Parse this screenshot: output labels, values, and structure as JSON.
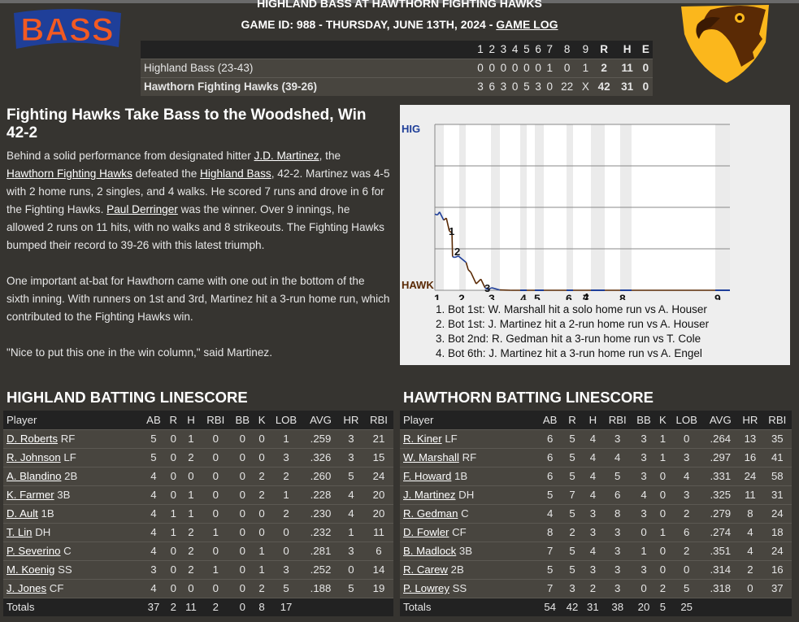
{
  "header": {
    "title": "HIGHLAND BASS AT HAWTHORN FIGHTING HAWKS",
    "subtitle": "GAME ID: 988 - THURSDAY, JUNE 13TH, 2024 - ",
    "game_log_link": "GAME LOG",
    "away_logo_text": "BASS",
    "colors": {
      "bass_orange": "#f25a23",
      "bass_blue": "#1f3f99",
      "hawk_gold": "#fbb71c",
      "hawk_brown": "#5a2a05"
    }
  },
  "linescore": {
    "headers": [
      "",
      "1",
      "2",
      "3",
      "4",
      "5",
      "6",
      "7",
      "8",
      "9",
      "R",
      "H",
      "E"
    ],
    "rows": [
      [
        "Highland Bass (23-43)",
        "0",
        "0",
        "0",
        "0",
        "0",
        "0",
        "1",
        "0",
        "1",
        "2",
        "11",
        "0"
      ],
      [
        "Hawthorn Fighting Hawks (39-26)",
        "3",
        "6",
        "3",
        "0",
        "5",
        "3",
        "0",
        "22",
        "X",
        "42",
        "31",
        "0"
      ]
    ]
  },
  "article": {
    "headline": "Fighting Hawks Take Bass to the Woodshed, Win 42-2",
    "p1": [
      {
        "t": "Behind a solid performance from designated hitter "
      },
      {
        "t": "J.D. Martinez",
        "link": true
      },
      {
        "t": ", the "
      },
      {
        "t": "Hawthorn Fighting Hawks",
        "link": true
      },
      {
        "t": " defeated the "
      },
      {
        "t": "Highland Bass",
        "link": true
      },
      {
        "t": ", 42-2. Martinez was 4-5 with 2 home runs, 2 singles, and 4 walks. He scored 7 runs and drove in 6 for the Fighting Hawks. "
      },
      {
        "t": "Paul Derringer",
        "link": true
      },
      {
        "t": " was the winner. Over 9 innings, he allowed 2 runs on 11 hits, with no walks and 8 strikeouts. The Fighting Hawks bumped their record to 39-26 with this latest triumph."
      }
    ],
    "p2": "One important at-bat for Hawthorn came with one out in the bottom of the sixth inning. With runners on 1st and 3rd, Martinez hit a 3-run home run, which contributed to the Fighting Hawks win.",
    "p3": "\"Nice to put this one in the win column,\" said Martinez."
  },
  "chart_data": {
    "type": "line",
    "top_label": "HIG",
    "bottom_label": "HAWK",
    "top_color": "#1f3f99",
    "bottom_color": "#5a2a05",
    "ylim": [
      0,
      100
    ],
    "xlim": [
      0,
      100
    ],
    "grid": true,
    "inning_labels": [
      "1",
      "2",
      "3",
      "4",
      "5",
      "6",
      "7",
      "8",
      "9"
    ],
    "points": [
      [
        0,
        45.9
      ],
      [
        0.9,
        45.4
      ],
      [
        1.6,
        47.2
      ],
      [
        3.0,
        42.3
      ],
      [
        3.9,
        43.5
      ],
      [
        4.9,
        35.8
      ],
      [
        5.8,
        34.5
      ],
      [
        6.0,
        20.3
      ],
      [
        6.7,
        19.8
      ],
      [
        8.0,
        20.6
      ],
      [
        10.6,
        16.8
      ],
      [
        11.3,
        12.4
      ],
      [
        12.2,
        10.8
      ],
      [
        14.0,
        3.9
      ],
      [
        15.6,
        6.7
      ],
      [
        17.0,
        1.5
      ],
      [
        17.9,
        0.5
      ],
      [
        19.3,
        1.5
      ],
      [
        22.0,
        0.2
      ],
      [
        25.7,
        0
      ],
      [
        100,
        0
      ]
    ],
    "annotations": [
      "1",
      "2",
      "3",
      "4"
    ],
    "notes": [
      "1. Bot 1st: W. Marshall hit a solo home run vs A. Houser",
      "2. Bot 1st: J. Martinez hit a 2-run home run vs A. Houser",
      "3. Bot 2nd: R. Gedman hit a 3-run home run vs T. Cole",
      "4. Bot 6th: J. Martinez hit a 3-run home run vs A. Engel"
    ]
  },
  "batting": [
    {
      "title": "HIGHLAND BATTING LINESCORE",
      "headers": [
        "Player",
        "AB",
        "R",
        "H",
        "RBI",
        "BB",
        "K",
        "LOB",
        "AVG",
        "HR",
        "RBI"
      ],
      "rows": [
        [
          "D. Roberts",
          "RF",
          "5",
          "0",
          "1",
          "0",
          "0",
          "0",
          "1",
          ".259",
          "3",
          "21"
        ],
        [
          "R. Johnson",
          "LF",
          "5",
          "0",
          "2",
          "0",
          "0",
          "0",
          "3",
          ".326",
          "3",
          "15"
        ],
        [
          "A. Blandino",
          "2B",
          "4",
          "0",
          "0",
          "0",
          "0",
          "2",
          "2",
          ".260",
          "5",
          "24"
        ],
        [
          "K. Farmer",
          "3B",
          "4",
          "0",
          "1",
          "0",
          "0",
          "2",
          "1",
          ".228",
          "4",
          "20"
        ],
        [
          "D. Ault",
          "1B",
          "4",
          "1",
          "1",
          "0",
          "0",
          "0",
          "2",
          ".230",
          "4",
          "20"
        ],
        [
          "T. Lin",
          "DH",
          "4",
          "1",
          "2",
          "1",
          "0",
          "0",
          "0",
          ".232",
          "1",
          "11"
        ],
        [
          "P. Severino",
          "C",
          "4",
          "0",
          "2",
          "0",
          "0",
          "1",
          "0",
          ".281",
          "3",
          "6"
        ],
        [
          "M. Koenig",
          "SS",
          "3",
          "0",
          "2",
          "1",
          "0",
          "1",
          "3",
          ".252",
          "0",
          "14"
        ],
        [
          "J. Jones",
          "CF",
          "4",
          "0",
          "0",
          "0",
          "0",
          "2",
          "5",
          ".188",
          "5",
          "19"
        ]
      ],
      "totals": [
        "Totals",
        "37",
        "2",
        "11",
        "2",
        "0",
        "8",
        "17",
        "",
        "",
        ""
      ]
    },
    {
      "title": "HAWTHORN BATTING LINESCORE",
      "headers": [
        "Player",
        "AB",
        "R",
        "H",
        "RBI",
        "BB",
        "K",
        "LOB",
        "AVG",
        "HR",
        "RBI"
      ],
      "rows": [
        [
          "R. Kiner",
          "LF",
          "6",
          "5",
          "4",
          "3",
          "3",
          "1",
          "0",
          ".264",
          "13",
          "35"
        ],
        [
          "W. Marshall",
          "RF",
          "6",
          "5",
          "4",
          "4",
          "3",
          "1",
          "3",
          ".297",
          "16",
          "41"
        ],
        [
          "F. Howard",
          "1B",
          "6",
          "5",
          "4",
          "5",
          "3",
          "0",
          "4",
          ".331",
          "24",
          "58"
        ],
        [
          "J. Martinez",
          "DH",
          "5",
          "7",
          "4",
          "6",
          "4",
          "0",
          "3",
          ".325",
          "11",
          "31"
        ],
        [
          "R. Gedman",
          "C",
          "4",
          "5",
          "3",
          "8",
          "3",
          "0",
          "2",
          ".279",
          "8",
          "24"
        ],
        [
          "D. Fowler",
          "CF",
          "8",
          "2",
          "3",
          "3",
          "0",
          "1",
          "6",
          ".274",
          "4",
          "18"
        ],
        [
          "B. Madlock",
          "3B",
          "7",
          "5",
          "4",
          "3",
          "1",
          "0",
          "2",
          ".351",
          "4",
          "24"
        ],
        [
          "R. Carew",
          "2B",
          "5",
          "5",
          "3",
          "3",
          "3",
          "0",
          "0",
          ".314",
          "2",
          "16"
        ],
        [
          "P. Lowrey",
          "SS",
          "7",
          "3",
          "2",
          "3",
          "0",
          "2",
          "5",
          ".318",
          "0",
          "37"
        ]
      ],
      "totals": [
        "Totals",
        "54",
        "42",
        "31",
        "38",
        "20",
        "5",
        "25",
        "",
        "",
        ""
      ]
    }
  ]
}
